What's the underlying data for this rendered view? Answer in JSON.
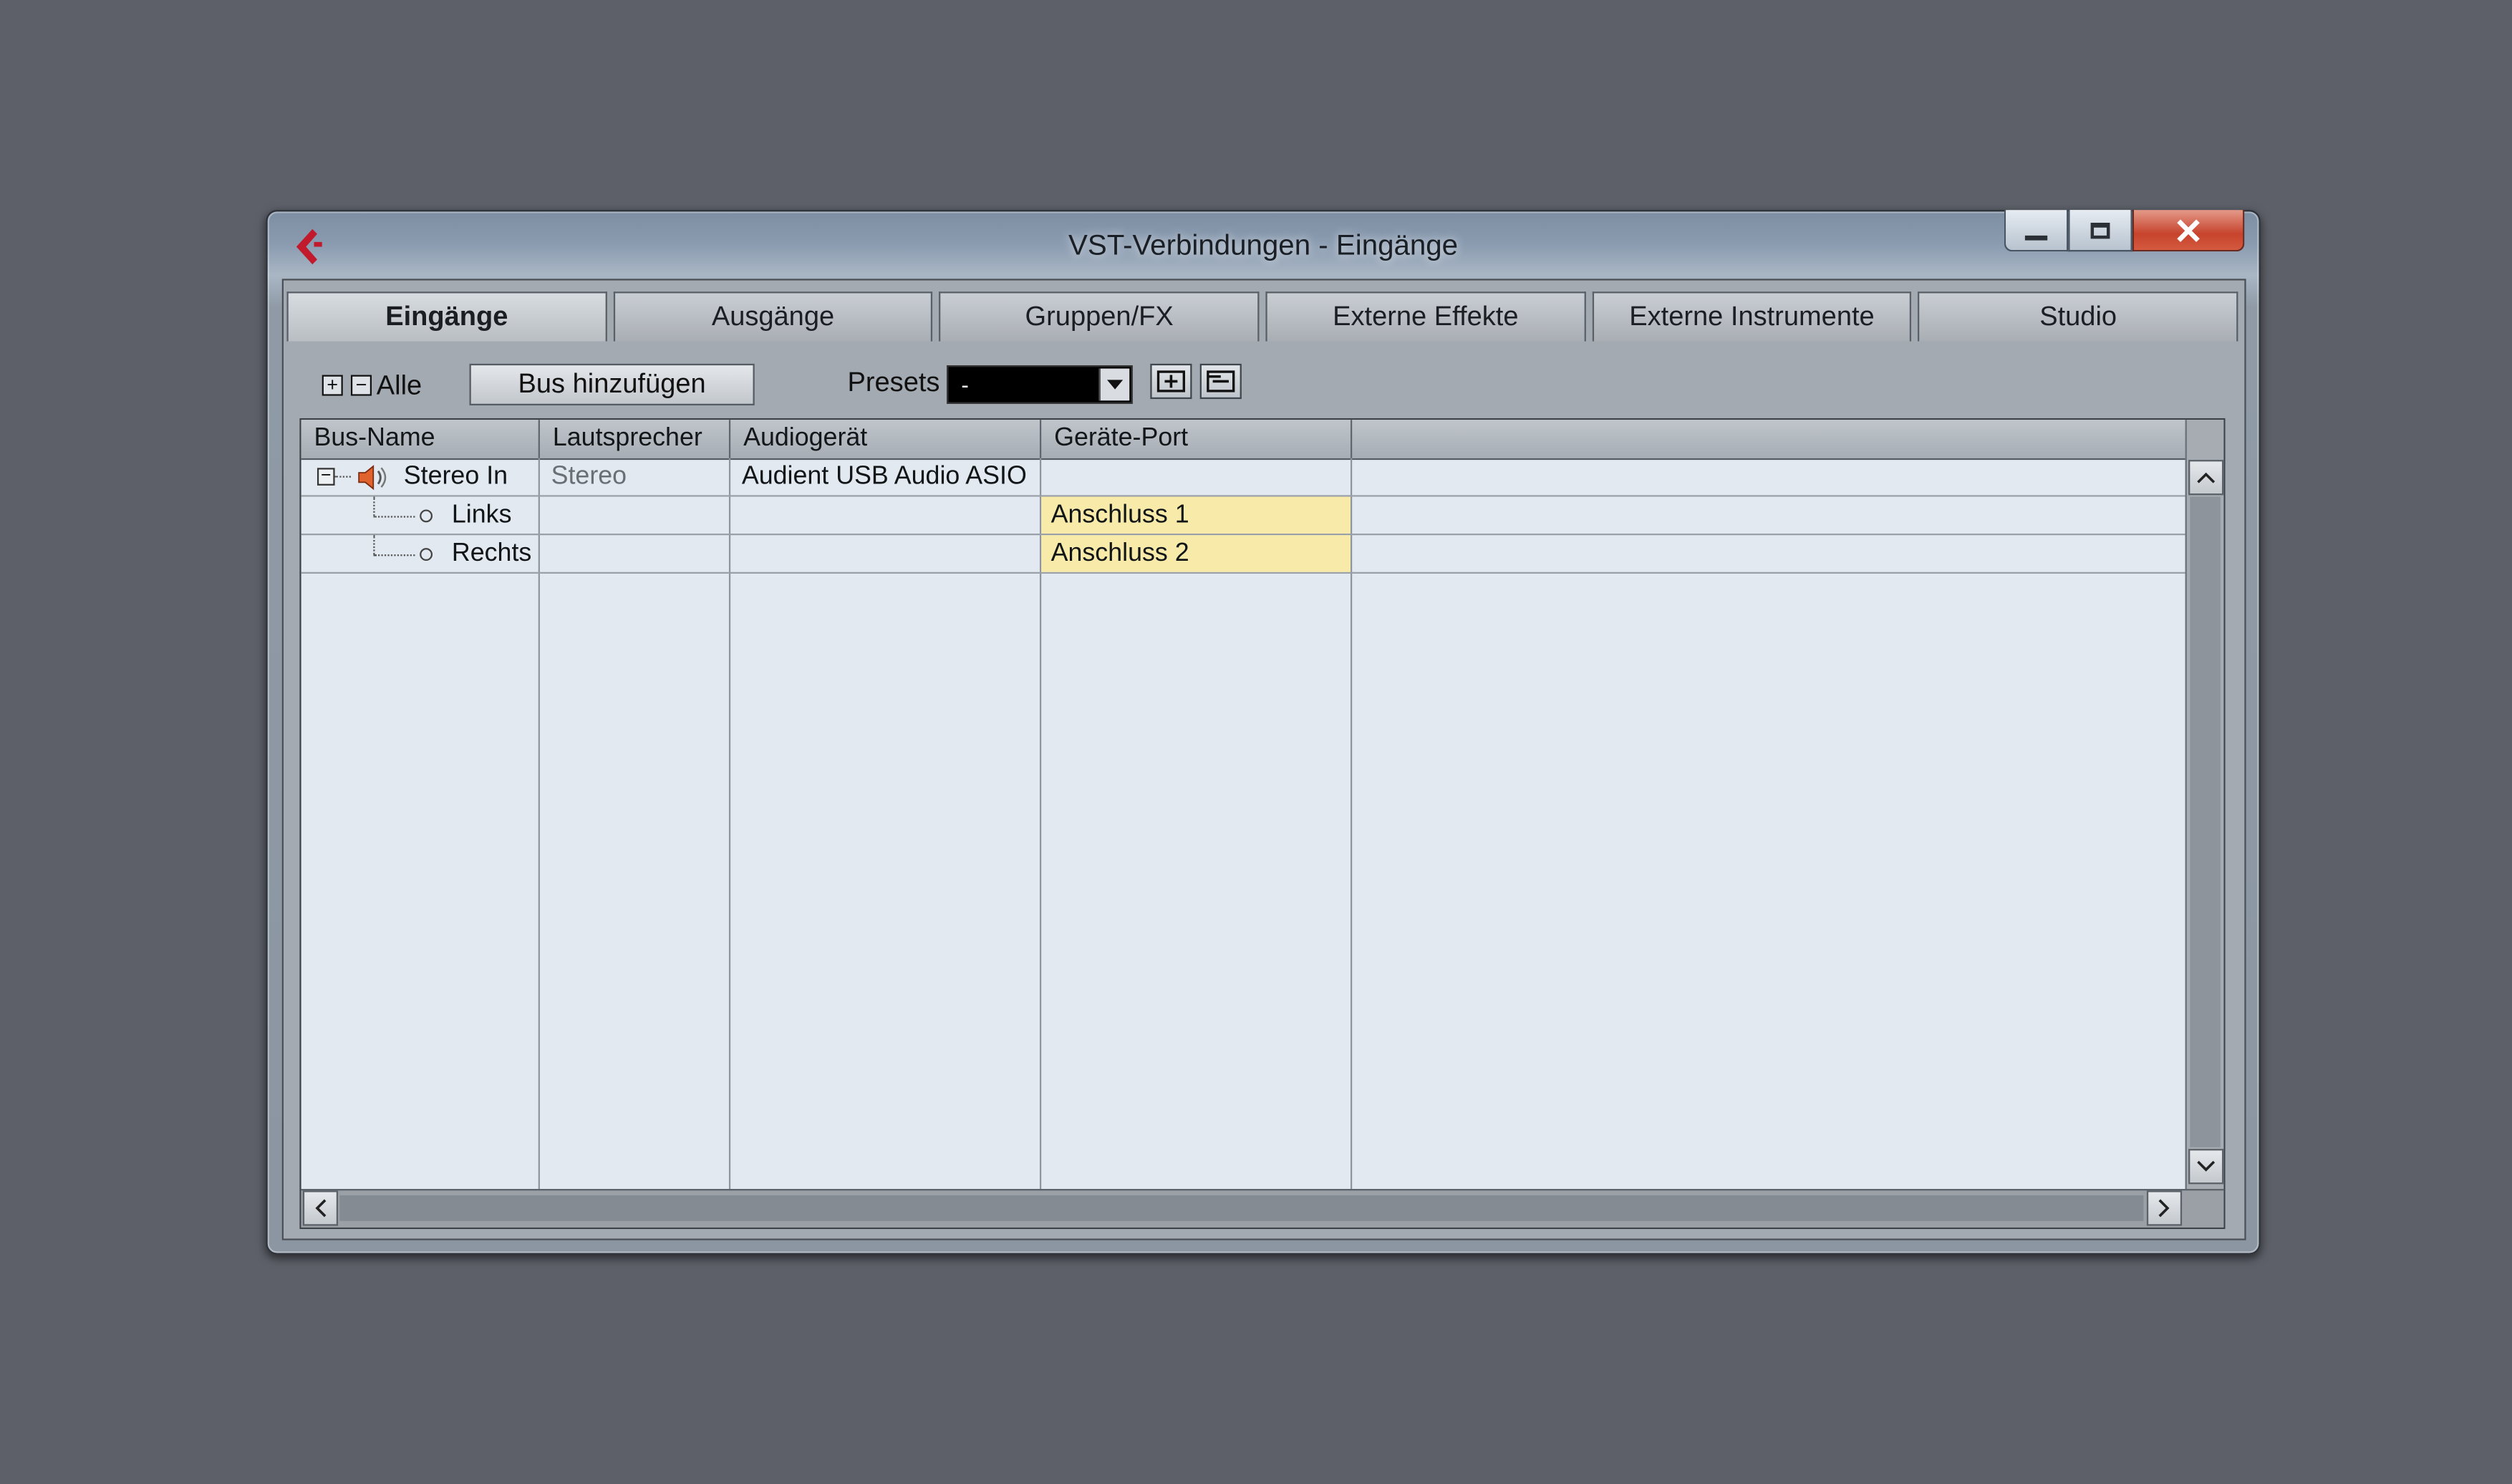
{
  "window": {
    "title": "VST-Verbindungen - Eingänge",
    "app_icon": "cubase-logo-icon",
    "accent_color": "#c7432c"
  },
  "caption_buttons": {
    "minimize_icon": "minimize-icon",
    "maximize_icon": "maximize-icon",
    "close_icon": "close-icon"
  },
  "tabs": [
    {
      "label": "Eingänge",
      "active": true
    },
    {
      "label": "Ausgänge"
    },
    {
      "label": "Gruppen/FX"
    },
    {
      "label": "Externe Effekte"
    },
    {
      "label": "Externe Instrumente"
    },
    {
      "label": "Studio"
    }
  ],
  "toolbar": {
    "expand_all_icon": "expand-all-icon",
    "collapse_all_icon": "collapse-all-icon",
    "all_label": "Alle",
    "add_bus_label": "Bus hinzufügen",
    "presets_label": "Presets",
    "presets_value": "-",
    "store_preset_icon": "store-preset-icon",
    "remove_preset_icon": "remove-preset-icon"
  },
  "table": {
    "columns": [
      "Bus-Name",
      "Lautsprecher",
      "Audiogerät",
      "Geräte-Port",
      ""
    ],
    "rows": [
      {
        "bus_name": "Stereo In",
        "speaker": "Stereo",
        "device": "Audient USB Audio ASIO",
        "port": "",
        "level": 0,
        "icon": "speaker-icon"
      },
      {
        "bus_name": "Links",
        "speaker": "",
        "device": "",
        "port": "Anschluss 1",
        "level": 1
      },
      {
        "bus_name": "Rechts",
        "speaker": "",
        "device": "",
        "port": "Anschluss 2",
        "level": 1
      }
    ],
    "port_highlight_color": "#f8eaa8"
  }
}
